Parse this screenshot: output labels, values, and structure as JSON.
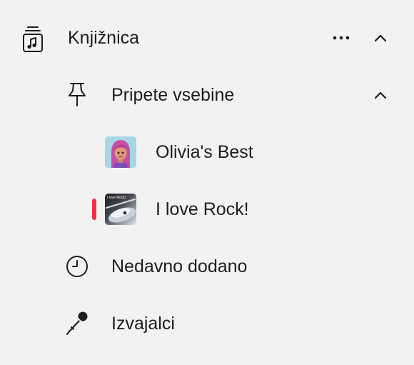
{
  "sidebar": {
    "library": {
      "label": "Knjižnica",
      "icon": "music-library-icon"
    },
    "pinned": {
      "label": "Pripete vsebine",
      "icon": "pin-icon"
    },
    "pinned_items": [
      {
        "label": "Olivia's Best",
        "artwork": "memoji-avatar"
      },
      {
        "label": "I love Rock!",
        "artwork": "playlist-artwork",
        "artwork_text": "I love Rock!"
      }
    ],
    "recently_added": {
      "label": "Nedavno dodano",
      "icon": "clock-icon"
    },
    "artists": {
      "label": "Izvajalci",
      "icon": "microphone-icon"
    }
  },
  "colors": {
    "background": "#f2f2f2",
    "text": "#1d1d1f",
    "accent": "#fa2d48"
  }
}
